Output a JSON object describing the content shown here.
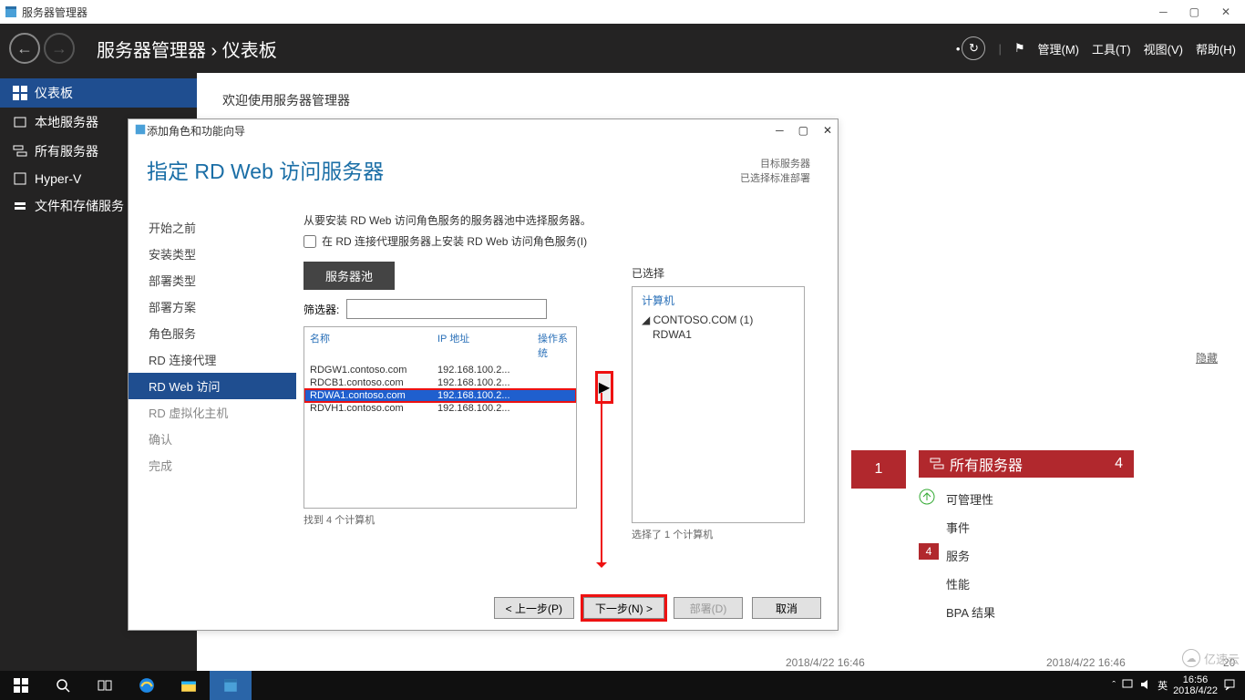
{
  "titlebar": {
    "app_name": "服务器管理器"
  },
  "header": {
    "title": "服务器管理器 › 仪表板",
    "menu": {
      "manage": "管理(M)",
      "tools": "工具(T)",
      "view": "视图(V)",
      "help": "帮助(H)"
    }
  },
  "leftnav": {
    "items": [
      {
        "label": "仪表板"
      },
      {
        "label": "本地服务器"
      },
      {
        "label": "所有服务器"
      },
      {
        "label": "Hyper-V"
      },
      {
        "label": "文件和存储服务"
      }
    ]
  },
  "content": {
    "welcome": "欢迎使用服务器管理器",
    "hide": "隐藏"
  },
  "tile": {
    "title": "所有服务器",
    "count": "4",
    "rows": {
      "manage": "可管理性",
      "events": "事件",
      "services": "服务",
      "services_badge": "4",
      "perf": "性能",
      "bpa": "BPA 结果"
    },
    "left_count": "1",
    "ts_left": "2018/4/22 16:46",
    "ts_right": "2018/4/22 16:46",
    "ts_far": "20"
  },
  "wizard": {
    "title": "添加角色和功能向导",
    "page_title": "指定 RD Web 访问服务器",
    "dest_label": "目标服务器",
    "dest_value": "已选择标准部署",
    "steps": [
      "开始之前",
      "安装类型",
      "部署类型",
      "部署方案",
      "角色服务",
      "RD 连接代理",
      "RD Web 访问",
      "RD 虚拟化主机",
      "确认",
      "完成"
    ],
    "instruction": "从要安装 RD Web 访问角色服务的服务器池中选择服务器。",
    "checkbox_label": "在 RD 连接代理服务器上安装 RD Web 访问角色服务(I)",
    "pool_tab": "服务器池",
    "filter_label": "筛选器:",
    "columns": {
      "name": "名称",
      "ip": "IP 地址",
      "os": "操作系统"
    },
    "rows": [
      {
        "name": "RDGW1.contoso.com",
        "ip": "192.168.100.2..."
      },
      {
        "name": "RDCB1.contoso.com",
        "ip": "192.168.100.2..."
      },
      {
        "name": "RDWA1.contoso.com",
        "ip": "192.168.100.2..."
      },
      {
        "name": "RDVH1.contoso.com",
        "ip": "192.168.100.2..."
      }
    ],
    "found": "找到 4 个计算机",
    "selected_label": "已选择",
    "selected_header": "计算机",
    "selected_domain": "◢ CONTOSO.COM (1)",
    "selected_node": "RDWA1",
    "selected_count": "选择了 1 个计算机",
    "buttons": {
      "prev": "< 上一步(P)",
      "next": "下一步(N) >",
      "deploy": "部署(D)",
      "cancel": "取消"
    }
  },
  "taskbar": {
    "ime": "英",
    "time": "16:56",
    "date": "2018/4/22"
  },
  "watermark": "亿速云"
}
